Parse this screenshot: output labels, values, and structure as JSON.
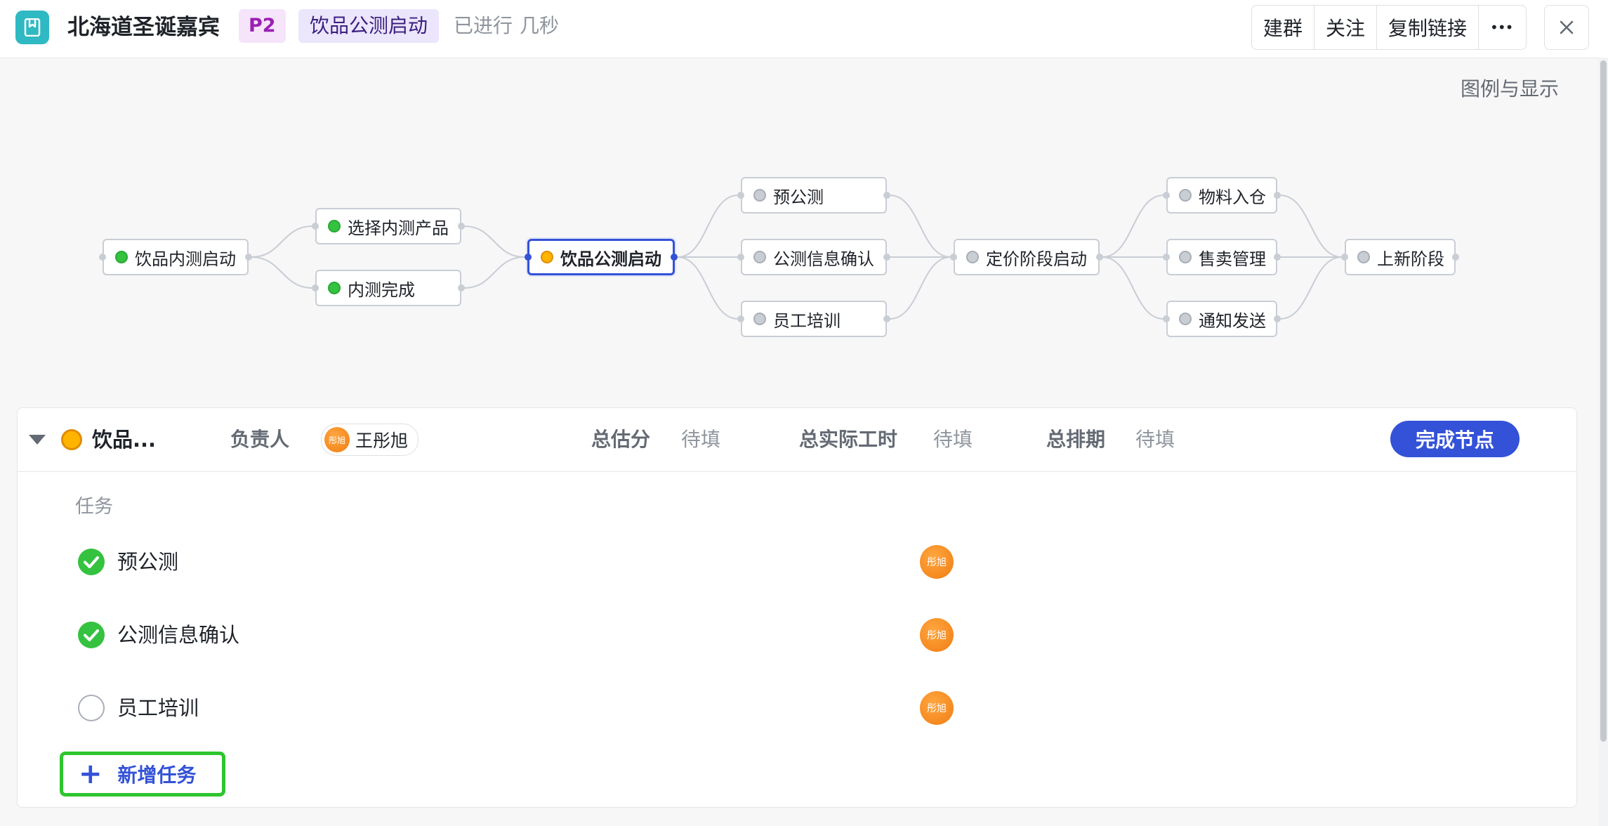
{
  "header": {
    "title": "北海道圣诞嘉宾",
    "priority_tag": "P2",
    "stage_tag": "饮品公测启动",
    "elapsed_prefix": "已进行",
    "elapsed_value": "几秒",
    "actions": {
      "create_group": "建群",
      "follow": "关注",
      "copy_link": "复制链接",
      "more": "•••"
    }
  },
  "flow": {
    "legend_link": "图例与显示",
    "nodes": [
      {
        "id": "n1",
        "label": "饮品内测启动",
        "status": "done"
      },
      {
        "id": "n2",
        "label": "选择内测产品",
        "status": "done"
      },
      {
        "id": "n3",
        "label": "内测完成",
        "status": "done"
      },
      {
        "id": "n4",
        "label": "饮品公测启动",
        "status": "active"
      },
      {
        "id": "n5",
        "label": "预公测",
        "status": "todo"
      },
      {
        "id": "n6",
        "label": "公测信息确认",
        "status": "todo"
      },
      {
        "id": "n7",
        "label": "员工培训",
        "status": "todo"
      },
      {
        "id": "n8",
        "label": "定价阶段启动",
        "status": "todo"
      },
      {
        "id": "n9",
        "label": "物料入仓",
        "status": "todo"
      },
      {
        "id": "n10",
        "label": "售卖管理",
        "status": "todo"
      },
      {
        "id": "n11",
        "label": "通知发送",
        "status": "todo"
      },
      {
        "id": "n12",
        "label": "上新阶段",
        "status": "todo"
      }
    ],
    "edges": [
      [
        "n1",
        "n2"
      ],
      [
        "n1",
        "n3"
      ],
      [
        "n2",
        "n4"
      ],
      [
        "n3",
        "n4"
      ],
      [
        "n4",
        "n5"
      ],
      [
        "n4",
        "n6"
      ],
      [
        "n4",
        "n7"
      ],
      [
        "n5",
        "n8"
      ],
      [
        "n6",
        "n8"
      ],
      [
        "n7",
        "n8"
      ],
      [
        "n8",
        "n9"
      ],
      [
        "n8",
        "n10"
      ],
      [
        "n8",
        "n11"
      ],
      [
        "n9",
        "n12"
      ],
      [
        "n10",
        "n12"
      ],
      [
        "n11",
        "n12"
      ]
    ]
  },
  "panel": {
    "node_name": "饮品...",
    "owner_label": "负责人",
    "owner_name": "王彤旭",
    "owner_avatar_text": "彤旭",
    "estimate_label": "总估分",
    "estimate_value": "待填",
    "actual_label": "总实际工时",
    "actual_value": "待填",
    "schedule_label": "总排期",
    "schedule_value": "待填",
    "complete_button": "完成节点",
    "tasks_heading": "任务",
    "tasks": [
      {
        "name": "预公测",
        "done": true,
        "assignee": "彤旭"
      },
      {
        "name": "公测信息确认",
        "done": true,
        "assignee": "彤旭"
      },
      {
        "name": "员工培训",
        "done": false,
        "assignee": "彤旭"
      }
    ],
    "add_task": "新增任务"
  },
  "colors": {
    "accent": "#3452d8",
    "done": "#34c240",
    "active": "#ffb400",
    "todo": "#c9cdd4",
    "highlight": "#2ec52e"
  }
}
